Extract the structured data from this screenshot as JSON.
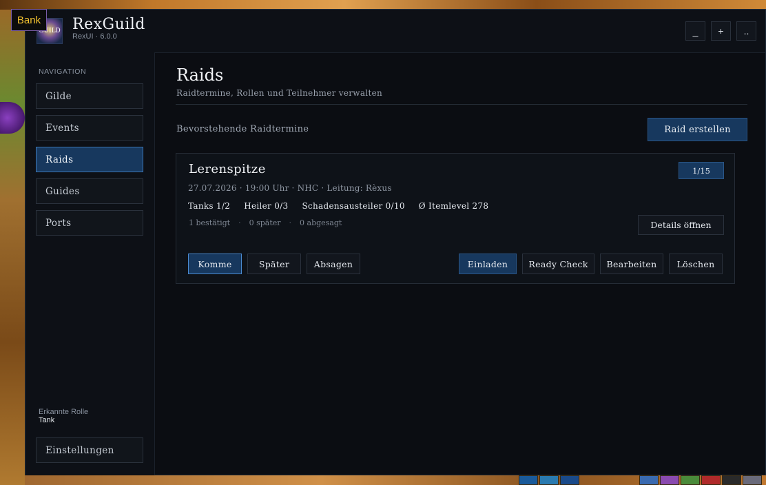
{
  "overlay": {
    "bank_label": "Bank"
  },
  "app": {
    "title": "RexGuild",
    "subtitle": "RexUI · 6.0.0",
    "logo_text": "GUILD"
  },
  "window_controls": {
    "minimize": "_",
    "add": "+",
    "more": ".."
  },
  "sidebar": {
    "heading": "NAVIGATION",
    "items": [
      {
        "label": "Gilde",
        "active": false
      },
      {
        "label": "Events",
        "active": false
      },
      {
        "label": "Raids",
        "active": true
      },
      {
        "label": "Guides",
        "active": false
      },
      {
        "label": "Ports",
        "active": false
      }
    ],
    "role_label": "Erkannte Rolle",
    "role_value": "Tank",
    "settings_label": "Einstellungen"
  },
  "main": {
    "title": "Raids",
    "subtitle": "Raidtermine, Rollen und Teilnehmer verwalten",
    "section_label": "Bevorstehende Raidtermine",
    "create_button": "Raid erstellen"
  },
  "raid_card": {
    "name": "Lerenspitze",
    "count": "1/15",
    "meta": "27.07.2026 · 19:00 Uhr · NHC · Leitung: Rèxus",
    "stats": {
      "tanks": "Tanks 1/2",
      "healers": "Heiler 0/3",
      "dps": "Schadensausteiler 0/10",
      "itemlevel": "Ø Itemlevel 278"
    },
    "rsvp": {
      "confirmed": "1 bestätigt",
      "later": "0 später",
      "declined": "0 abgesagt",
      "separator": "·"
    },
    "details_button": "Details öffnen",
    "actions": {
      "come": "Komme",
      "later": "Später",
      "decline": "Absagen",
      "invite": "Einladen",
      "ready_check": "Ready Check",
      "edit": "Bearbeiten",
      "delete": "Löschen"
    }
  },
  "colors": {
    "accent": "#17385e",
    "accent_border": "#3d78b8",
    "panel": "#0b0d12",
    "bank_text": "#f2c230"
  }
}
